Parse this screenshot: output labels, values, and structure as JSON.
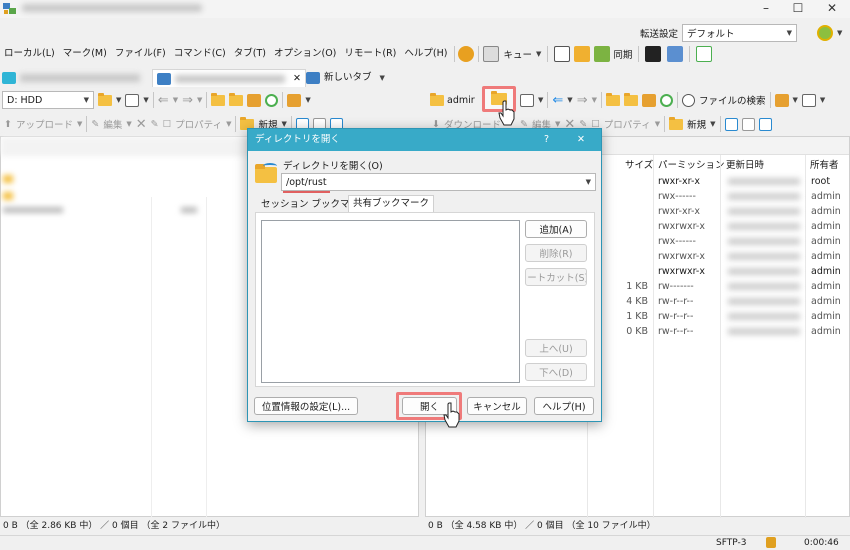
{
  "menubar": {
    "items": [
      "ローカル(L)",
      "マーク(M)",
      "ファイル(F)",
      "コマンド(C)",
      "タブ(T)",
      "オプション(O)",
      "リモート(R)",
      "ヘルプ(H)"
    ],
    "queue_label": "キュー",
    "sync_label": "同期"
  },
  "transfer": {
    "label": "転送設定",
    "value": "デフォルト"
  },
  "tabs": {
    "new_tab": "新しいタブ"
  },
  "left": {
    "drive": "D: HDD",
    "new_label": "新規",
    "upload_label": "アップロード",
    "edit_label": "編集",
    "properties_label": "プロパティ",
    "status": "0 B （全 2.86 KB 中） ／ 0 個目 （全 2 ファイル中）"
  },
  "right": {
    "path": "admir",
    "find_label": "ファイルの検索",
    "download_label": "ダウンロード",
    "edit_label": "編集",
    "properties_label": "プロパティ",
    "new_label": "新規",
    "columns": {
      "size": "サイズ",
      "perm": "パーミッション",
      "modified": "更新日時",
      "owner": "所有者"
    },
    "rows": [
      {
        "size": "",
        "perm": "rwxr-xr-x",
        "owner": "root",
        "dark": true
      },
      {
        "size": "",
        "perm": "rwx------",
        "owner": "admin",
        "dark": false
      },
      {
        "size": "",
        "perm": "rwxr-xr-x",
        "owner": "admin",
        "dark": false
      },
      {
        "size": "",
        "perm": "rwxrwxr-x",
        "owner": "admin",
        "dark": false
      },
      {
        "size": "",
        "perm": "rwx------",
        "owner": "admin",
        "dark": false
      },
      {
        "size": "",
        "perm": "rwxrwxr-x",
        "owner": "admin",
        "dark": false
      },
      {
        "size": "",
        "perm": "rwxrwxr-x",
        "owner": "admin",
        "dark": true
      },
      {
        "size": "1 KB",
        "perm": "rw-------",
        "owner": "admin",
        "dark": false
      },
      {
        "size": "4 KB",
        "perm": "rw-r--r--",
        "owner": "admin",
        "dark": false
      },
      {
        "size": "1 KB",
        "perm": "rw-r--r--",
        "owner": "admin",
        "dark": false
      },
      {
        "size": "0 KB",
        "perm": "rw-r--r--",
        "owner": "admin",
        "dark": false
      }
    ],
    "status": "0 B （全 4.58 KB 中） ／ 0 個目 （全 10 ファイル中）"
  },
  "statusbar": {
    "protocol": "SFTP-3",
    "time": "0:00:46"
  },
  "dialog": {
    "title": "ディレクトリを開く",
    "help_char": "?",
    "close_char": "✕",
    "label": "ディレクトリを開く(O)",
    "path": "/opt/rust",
    "tabs": [
      "セッション ブックマーク",
      "共有ブックマーク"
    ],
    "side_buttons": {
      "add": "追加(A)",
      "delete": "削除(R)",
      "shortcut": "ョートカット(S)..",
      "up": "上へ(U)",
      "down": "下へ(D)"
    },
    "location_button": "位置情報の設定(L)...",
    "open_button": "開く",
    "cancel_button": "キャンセル",
    "help_button": "ヘルプ(H)"
  },
  "colors": {
    "accent": "#38aac8",
    "highlight": "#ef7a7a"
  }
}
